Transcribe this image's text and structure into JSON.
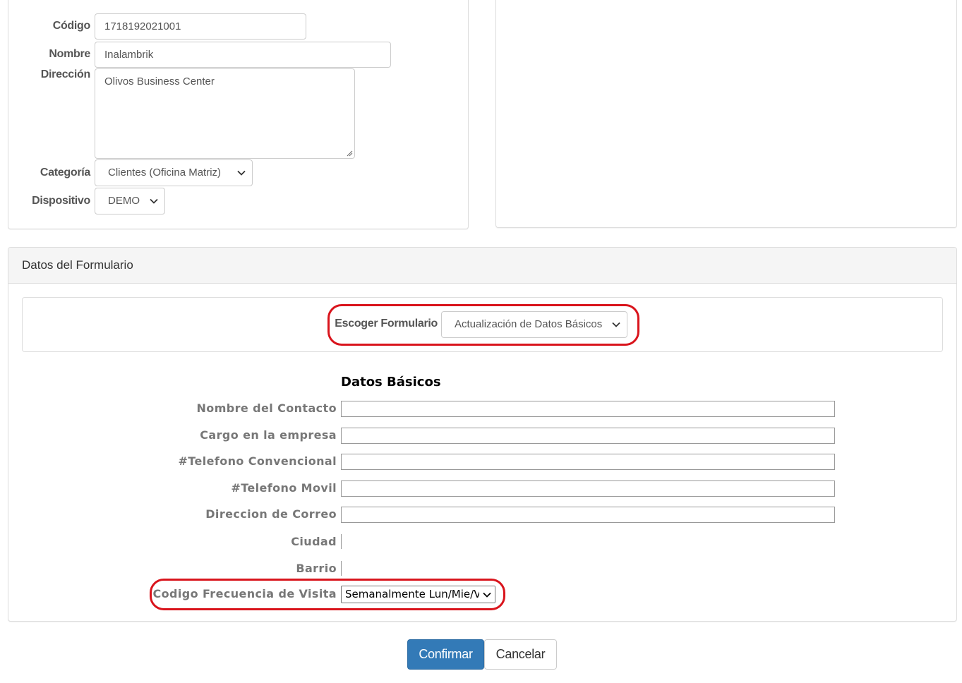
{
  "client": {
    "codigo_label": "Código",
    "codigo_value": "1718192021001",
    "nombre_label": "Nombre",
    "nombre_value": "Inalambrik",
    "direccion_label": "Dirección",
    "direccion_value": "Olivos Business Center",
    "categoria_label": "Categoría",
    "categoria_value": "Clientes (Oficina Matriz)",
    "dispositivo_label": "Dispositivo",
    "dispositivo_value": "DEMO"
  },
  "form_panel": {
    "heading": "Datos del Formulario",
    "escoger_label": "Escoger Formulario",
    "escoger_value": "Actualización de Datos Básicos"
  },
  "datos_basicos": {
    "title": "Datos Básicos",
    "fields": [
      {
        "label": "Nombre del Contacto",
        "value": ""
      },
      {
        "label": "Cargo en la empresa",
        "value": ""
      },
      {
        "label": "#Telefono Convencional",
        "value": ""
      },
      {
        "label": "#Telefono Movil",
        "value": ""
      },
      {
        "label": "Direccion de Correo",
        "value": ""
      },
      {
        "label": "Ciudad"
      },
      {
        "label": "Barrio"
      }
    ],
    "frecuencia_label": "Codigo Frecuencia de Visita",
    "frecuencia_value": "Semanalmente Lun/Mie/Vie"
  },
  "actions": {
    "confirm_label": "Confirmar",
    "cancel_label": "Cancelar"
  },
  "colors": {
    "primary": "#337ab7",
    "highlight_ring": "#d9141c"
  },
  "icons": {
    "select_arrow": "chevron-down-icon",
    "textarea_resize": "resize-handle-icon"
  }
}
